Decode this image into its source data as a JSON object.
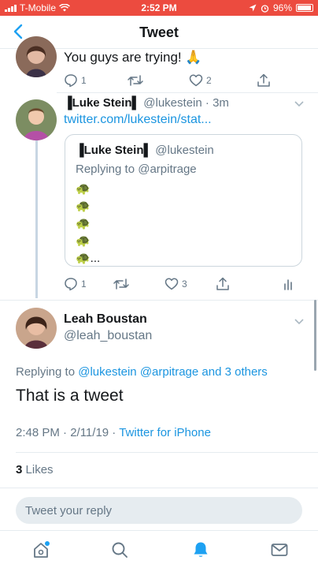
{
  "status_bar": {
    "carrier": "T-Mobile",
    "time": "2:52 PM",
    "battery": "96%"
  },
  "header": {
    "title": "Tweet"
  },
  "thread": [
    {
      "text": "You guys are trying! 🙏",
      "actions": {
        "reply_count": "1",
        "retweet_count": "",
        "like_count": "2"
      }
    },
    {
      "name": "▐Luke Stein▌",
      "handle": "@lukestein",
      "time": "3m",
      "link_text": "twitter.com/lukestein/stat...",
      "quote": {
        "name": "▐Luke Stein▌",
        "handle": "@lukestein",
        "replying_prefix": "Replying to",
        "replying_to": "@arpitrage",
        "turtles": [
          "🐢",
          "🐢",
          "🐢",
          "🐢",
          "🐢..."
        ]
      },
      "actions": {
        "reply_count": "1",
        "retweet_count": "",
        "like_count": "3"
      }
    }
  ],
  "main_tweet": {
    "name": "Leah Boustan",
    "handle": "@leah_boustan",
    "replying_prefix": "Replying to",
    "replying_to": "@lukestein @arpitrage and 3 others",
    "text": "That is a tweet",
    "timestamp": "2:48 PM · 2/11/19 · ",
    "source": "Twitter for iPhone",
    "likes_count": "3",
    "likes_label": "Likes"
  },
  "reply_bar": {
    "placeholder": "Tweet your reply"
  },
  "colors": {
    "status_bar_bg": "#ec4b3f",
    "accent": "#1da1f2",
    "link": "#1b95e0",
    "muted": "#657786"
  },
  "icons": [
    "back-arrow-icon",
    "reply-icon",
    "retweet-icon",
    "like-icon",
    "share-icon",
    "analytics-icon",
    "chevron-down-icon",
    "home-icon",
    "search-icon",
    "notifications-icon",
    "messages-icon"
  ]
}
